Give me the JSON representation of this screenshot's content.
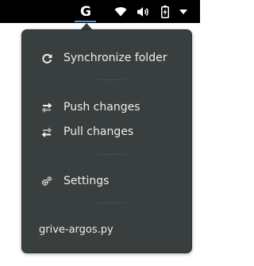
{
  "topbar": {
    "indicator_label": "G",
    "icons": [
      "wifi-icon",
      "volume-icon",
      "battery-charging-icon",
      "dropdown-arrow-icon"
    ],
    "accent_color": "#4a90d9",
    "background_color": "#000000"
  },
  "menu": {
    "background_color": "#393f3f",
    "items": [
      {
        "label": "Synchronize folder",
        "icon": "refresh-icon"
      },
      {
        "label": "Push changes",
        "icon": "push-arrows-icon"
      },
      {
        "label": "Pull changes",
        "icon": "pull-arrows-icon"
      },
      {
        "label": "Settings",
        "icon": "settings-gears-icon"
      }
    ],
    "footer_label": "grive-argos.py"
  }
}
